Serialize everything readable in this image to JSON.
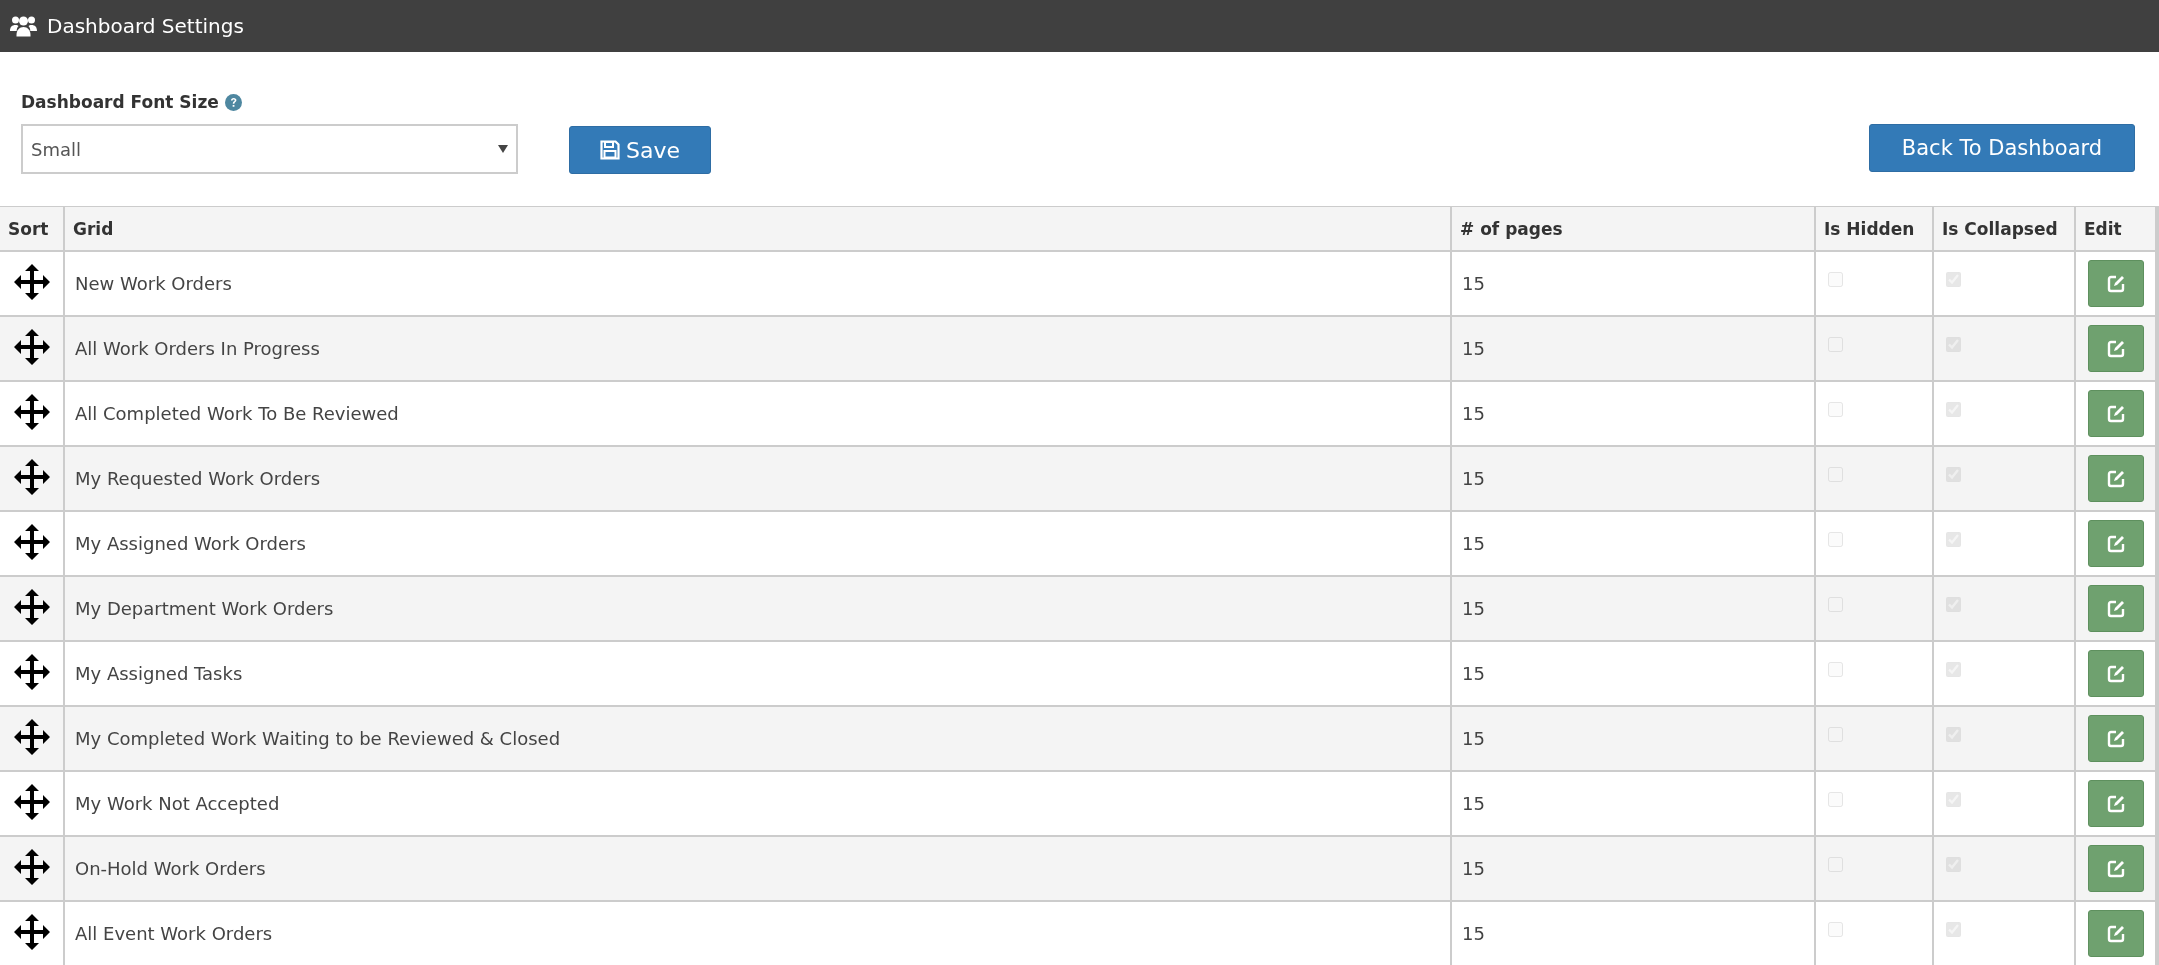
{
  "header": {
    "title": "Dashboard Settings"
  },
  "settings": {
    "font_size_label": "Dashboard Font Size",
    "font_size_value": "Small",
    "save_button": "Save",
    "back_button": "Back To Dashboard"
  },
  "table": {
    "columns": [
      "Sort",
      "Grid",
      "# of pages",
      "Is Hidden",
      "Is Collapsed",
      "Edit"
    ],
    "rows": [
      {
        "grid": "New Work Orders",
        "pages": "15",
        "is_hidden": {
          "checked": false,
          "disabled": true
        },
        "is_collapsed": {
          "checked": true,
          "disabled": true
        }
      },
      {
        "grid": "All Work Orders In Progress",
        "pages": "15",
        "is_hidden": {
          "checked": false,
          "disabled": true
        },
        "is_collapsed": {
          "checked": true,
          "disabled": true
        }
      },
      {
        "grid": "All Completed Work To Be Reviewed",
        "pages": "15",
        "is_hidden": {
          "checked": false,
          "disabled": true
        },
        "is_collapsed": {
          "checked": true,
          "disabled": true
        }
      },
      {
        "grid": "My Requested Work Orders",
        "pages": "15",
        "is_hidden": {
          "checked": false,
          "disabled": true
        },
        "is_collapsed": {
          "checked": true,
          "disabled": true
        }
      },
      {
        "grid": "My Assigned Work Orders",
        "pages": "15",
        "is_hidden": {
          "checked": false,
          "disabled": true
        },
        "is_collapsed": {
          "checked": true,
          "disabled": true
        }
      },
      {
        "grid": "My Department Work Orders",
        "pages": "15",
        "is_hidden": {
          "checked": false,
          "disabled": true
        },
        "is_collapsed": {
          "checked": true,
          "disabled": true
        }
      },
      {
        "grid": "My Assigned Tasks",
        "pages": "15",
        "is_hidden": {
          "checked": false,
          "disabled": true
        },
        "is_collapsed": {
          "checked": true,
          "disabled": true
        }
      },
      {
        "grid": "My Completed Work Waiting to be Reviewed & Closed",
        "pages": "15",
        "is_hidden": {
          "checked": false,
          "disabled": true
        },
        "is_collapsed": {
          "checked": true,
          "disabled": true
        }
      },
      {
        "grid": "My Work Not Accepted",
        "pages": "15",
        "is_hidden": {
          "checked": false,
          "disabled": true
        },
        "is_collapsed": {
          "checked": true,
          "disabled": true
        }
      },
      {
        "grid": "On-Hold Work Orders",
        "pages": "15",
        "is_hidden": {
          "checked": false,
          "disabled": true
        },
        "is_collapsed": {
          "checked": true,
          "disabled": true
        }
      },
      {
        "grid": "All Event Work Orders",
        "pages": "15",
        "is_hidden": {
          "checked": false,
          "disabled": true
        },
        "is_collapsed": {
          "checked": true,
          "disabled": true
        }
      }
    ]
  }
}
